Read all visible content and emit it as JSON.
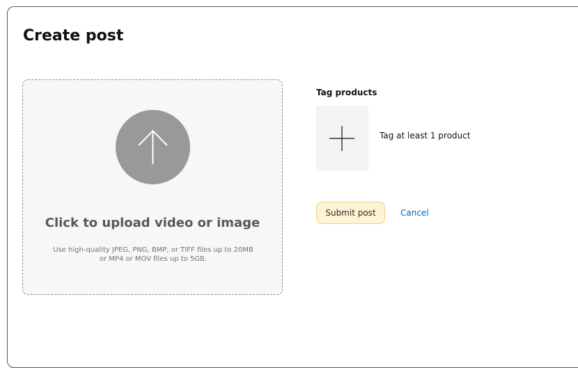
{
  "page": {
    "title": "Create post"
  },
  "upload": {
    "title": "Click to upload video or image",
    "hint": "Use high-quality JPEG, PNG, BMP, or TIFF files up to 20MB or MP4 or MOV files up to 5GB.",
    "icon": "arrow-up-icon"
  },
  "tags": {
    "heading": "Tag products",
    "add_icon": "plus-icon",
    "hint": "Tag at least 1 product"
  },
  "actions": {
    "submit_label": "Submit post",
    "cancel_label": "Cancel"
  },
  "colors": {
    "upload_circle": "#999999",
    "submit_bg": "#fdf4d3",
    "submit_border": "#f3d078",
    "link": "#0066c0"
  }
}
